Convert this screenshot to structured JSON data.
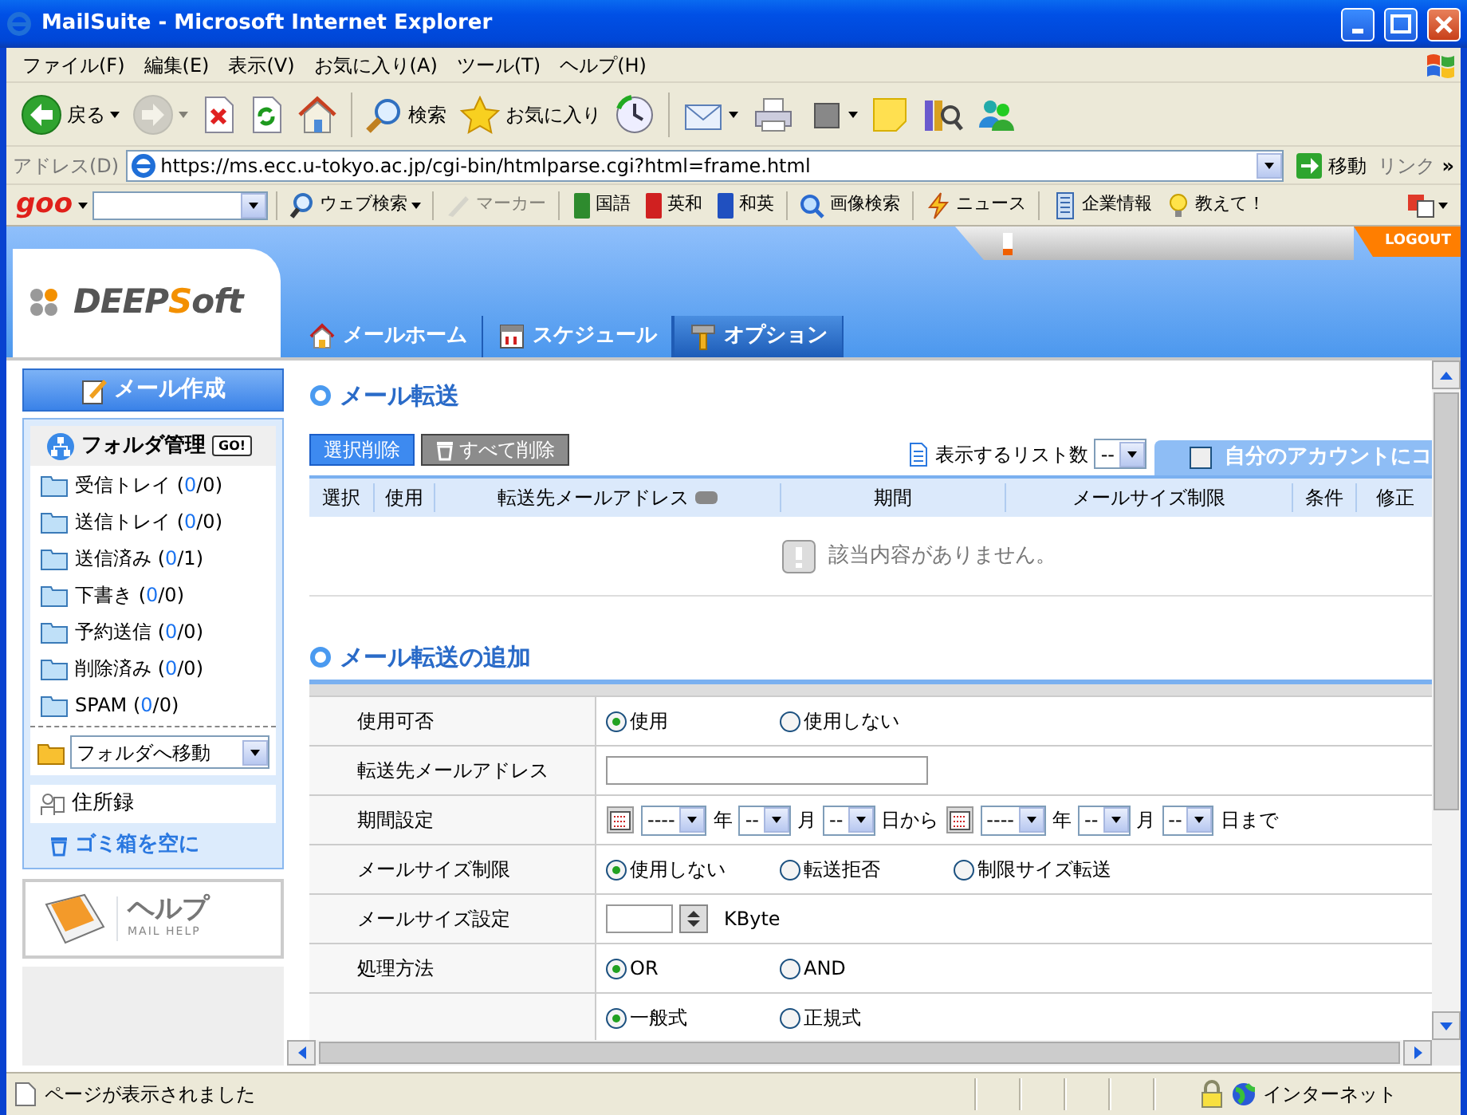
{
  "window": {
    "title": "MailSuite - Microsoft Internet Explorer"
  },
  "menu": [
    "ファイル(F)",
    "編集(E)",
    "表示(V)",
    "お気に入り(A)",
    "ツール(T)",
    "ヘルプ(H)"
  ],
  "toolbar": [
    [
      {
        "kind": "back",
        "label": "戻る",
        "dropdown": true,
        "disabled": false
      },
      {
        "kind": "forward",
        "dropdown": true,
        "disabled": true
      },
      {
        "kind": "stop",
        "dropdown": false,
        "disabled": false
      },
      {
        "kind": "refresh",
        "dropdown": false,
        "disabled": false
      },
      {
        "kind": "home",
        "dropdown": false,
        "disabled": false
      }
    ],
    [
      {
        "kind": "search",
        "label": "検索",
        "dropdown": false,
        "disabled": false
      },
      {
        "kind": "favorites",
        "label": "お気に入り",
        "dropdown": false,
        "disabled": false
      },
      {
        "kind": "history",
        "dropdown": false,
        "disabled": false
      }
    ],
    [
      {
        "kind": "mail",
        "dropdown": true,
        "disabled": false
      },
      {
        "kind": "print",
        "dropdown": false,
        "disabled": false
      },
      {
        "kind": "edit",
        "dropdown": true,
        "disabled": false
      },
      {
        "kind": "note",
        "dropdown": false,
        "disabled": false
      },
      {
        "kind": "research",
        "dropdown": false,
        "disabled": false
      },
      {
        "kind": "messenger",
        "dropdown": false,
        "disabled": false
      }
    ]
  ],
  "address": {
    "label": "アドレス(D)",
    "url": "https://ms.ecc.u-tokyo.ac.jp/cgi-bin/htmlparse.cgi?html=frame.html",
    "go": "移動",
    "links": "リンク",
    "more": "»"
  },
  "goo": {
    "logo": "goo",
    "groups": [
      [
        {
          "kind": "search",
          "label": "ウェブ検索",
          "dropdown": true,
          "disabled": false
        }
      ],
      [
        {
          "kind": "marker",
          "label": "マーカー",
          "dropdown": false,
          "disabled": true
        }
      ],
      [
        {
          "kind": "book",
          "label": "国語",
          "color": "#2e8b2e",
          "dropdown": false,
          "disabled": false
        },
        {
          "kind": "book",
          "label": "英和",
          "color": "#d02020",
          "dropdown": false,
          "disabled": false
        },
        {
          "kind": "book",
          "label": "和英",
          "color": "#2050c0",
          "dropdown": false,
          "disabled": false
        }
      ],
      [
        {
          "kind": "image",
          "label": "画像検索",
          "dropdown": false,
          "disabled": false
        }
      ],
      [
        {
          "kind": "news",
          "label": "ニュース",
          "dropdown": false,
          "disabled": false
        }
      ],
      [
        {
          "kind": "company",
          "label": "企業情報",
          "dropdown": false,
          "disabled": false
        },
        {
          "kind": "bulb",
          "label": "教えて！",
          "dropdown": false,
          "disabled": false
        }
      ]
    ]
  },
  "header": {
    "logo": {
      "prefix": "DEEP",
      "accent": "S",
      "suffix": "oft"
    },
    "tabs": [
      {
        "kind": "home",
        "label": "メールホーム",
        "selected": false
      },
      {
        "kind": "calendar",
        "label": "スケジュール",
        "selected": false
      },
      {
        "kind": "wrench",
        "label": "オプション",
        "selected": true
      }
    ],
    "logout": "LOGOUT"
  },
  "sidebar": {
    "compose": "メール作成",
    "folder_title": "フォルダ管理",
    "go": "GO!",
    "folders": [
      {
        "name": "受信トレイ",
        "count_open": "(",
        "unread": "0",
        "count_close": "/0)"
      },
      {
        "name": "送信トレイ",
        "count_open": "(",
        "unread": "0",
        "count_close": "/0)"
      },
      {
        "name": "送信済み",
        "count_open": "(",
        "unread": "0",
        "count_close": "/1)"
      },
      {
        "name": "下書き",
        "count_open": "(",
        "unread": "0",
        "count_close": "/0)"
      },
      {
        "name": "予約送信",
        "count_open": "(",
        "unread": "0",
        "count_close": "/0)"
      },
      {
        "name": "削除済み",
        "count_open": "(",
        "unread": "0",
        "count_close": "/0)"
      },
      {
        "name": "SPAM",
        "count_open": "(",
        "unread": "0",
        "count_close": "/0)"
      }
    ],
    "move_to_folder": "フォルダへ移動",
    "address_book": "住所録",
    "empty_trash": "ゴミ箱を空に",
    "help": "ヘルプ",
    "help_subtitle": "MAIL HELP"
  },
  "main": {
    "title": "メール転送",
    "buttons": [
      {
        "kind": "primary",
        "label": "選択削除"
      },
      {
        "kind": "trash",
        "label": "すべて削除"
      }
    ],
    "list_count": {
      "label": "表示するリスト数",
      "value": "--"
    },
    "copy": {
      "label": "自分のアカウントにコ",
      "checked": false
    },
    "columns": [
      "選択",
      "使用",
      "転送先メールアドレス",
      "期間",
      "メールサイズ制限",
      "条件",
      "修正"
    ],
    "empty_message": "該当内容がありません。",
    "add_title": "メール転送の追加",
    "form": [
      {
        "label": "使用可否",
        "kind": "radio",
        "options": [
          {
            "label": "使用",
            "selected": true
          },
          {
            "label": "使用しない",
            "selected": false
          }
        ]
      },
      {
        "label": "転送先メールアドレス",
        "kind": "text"
      },
      {
        "label": "期間設定",
        "kind": "date",
        "parts": [
          {
            "kind": "calendar"
          },
          {
            "kind": "select",
            "value": "----"
          },
          {
            "kind": "unit",
            "text": "年"
          },
          {
            "kind": "select",
            "value": "--"
          },
          {
            "kind": "unit",
            "text": "月"
          },
          {
            "kind": "select",
            "value": "--"
          },
          {
            "kind": "unit",
            "text": "日から"
          },
          {
            "kind": "calendar"
          },
          {
            "kind": "select",
            "value": "----"
          },
          {
            "kind": "unit",
            "text": "年"
          },
          {
            "kind": "select",
            "value": "--"
          },
          {
            "kind": "unit",
            "text": "月"
          },
          {
            "kind": "select",
            "value": "--"
          },
          {
            "kind": "unit",
            "text": "日まで"
          }
        ]
      },
      {
        "label": "メールサイズ制限",
        "kind": "radio",
        "options": [
          {
            "label": "使用しない",
            "selected": true
          },
          {
            "label": "転送拒否",
            "selected": false
          },
          {
            "label": "制限サイズ転送",
            "selected": false
          }
        ]
      },
      {
        "label": "メールサイズ設定",
        "kind": "spinner",
        "unit": "KByte"
      },
      {
        "label": "処理方法",
        "kind": "radio",
        "options": [
          {
            "label": "OR",
            "selected": true
          },
          {
            "label": "AND",
            "selected": false
          }
        ]
      },
      {
        "kind": "radio",
        "options": [
          {
            "label": "一般式",
            "selected": true
          },
          {
            "label": "正規式",
            "selected": false
          }
        ]
      }
    ]
  },
  "status_bar": {
    "text": "ページが表示されました",
    "zone": "インターネット"
  }
}
